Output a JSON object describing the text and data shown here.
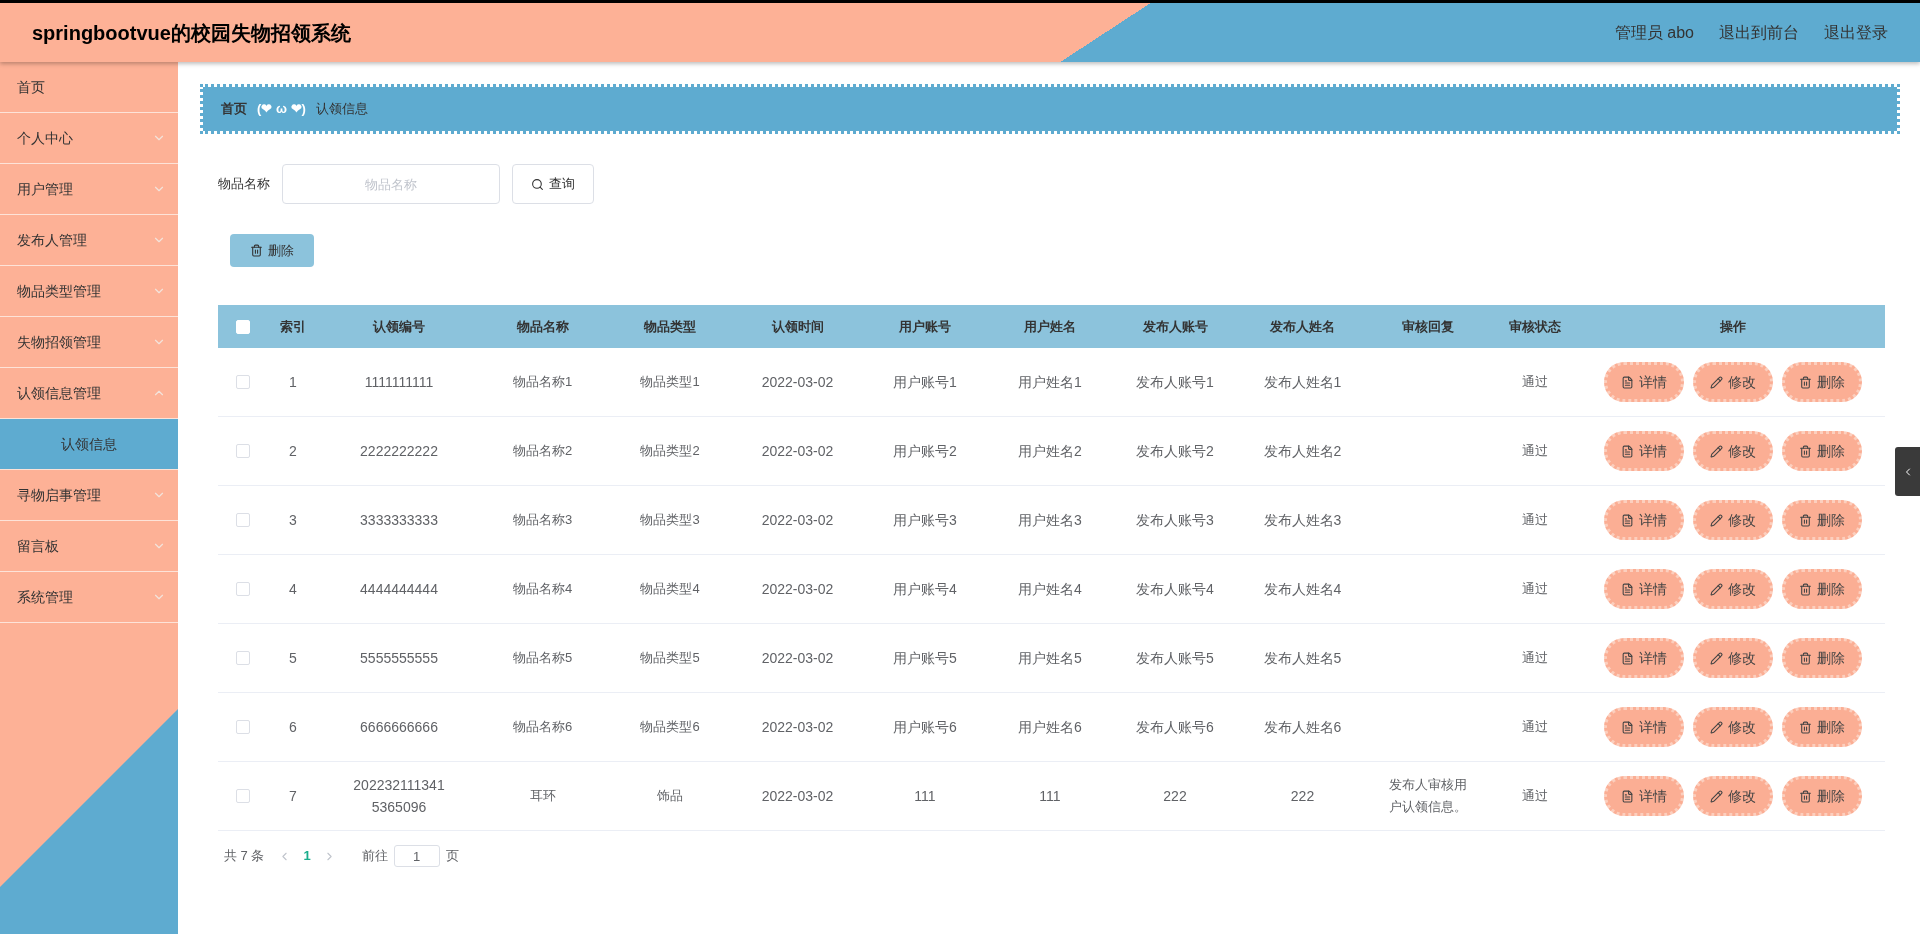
{
  "header": {
    "title": "springbootvue的校园失物招领系统",
    "user": "管理员 abo",
    "links": [
      "退出到前台",
      "退出登录"
    ]
  },
  "sidebar": {
    "items": [
      {
        "label": "首页",
        "kind": "link"
      },
      {
        "label": "个人中心",
        "kind": "menu",
        "expanded": false
      },
      {
        "label": "用户管理",
        "kind": "menu",
        "expanded": false
      },
      {
        "label": "发布人管理",
        "kind": "menu",
        "expanded": false
      },
      {
        "label": "物品类型管理",
        "kind": "menu",
        "expanded": false
      },
      {
        "label": "失物招领管理",
        "kind": "menu",
        "expanded": false
      },
      {
        "label": "认领信息管理",
        "kind": "menu",
        "expanded": true,
        "children": [
          {
            "label": "认领信息",
            "selected": true
          }
        ]
      },
      {
        "label": "寻物启事管理",
        "kind": "menu",
        "expanded": false
      },
      {
        "label": "留言板",
        "kind": "menu",
        "expanded": false
      },
      {
        "label": "系统管理",
        "kind": "menu",
        "expanded": false
      }
    ]
  },
  "breadcrumb": {
    "items": [
      "首页",
      "认领信息"
    ],
    "separator": "(❤ ω ❤)"
  },
  "search": {
    "label": "物品名称",
    "placeholder": "物品名称",
    "button": "查询"
  },
  "toolbar": {
    "delete_button": "删除"
  },
  "table": {
    "select_all_checked": false,
    "columns": [
      "索引",
      "认领编号",
      "物品名称",
      "物品类型",
      "认领时间",
      "用户账号",
      "用户姓名",
      "发布人账号",
      "发布人姓名",
      "审核回复",
      "审核状态",
      "操作"
    ],
    "rows": [
      {
        "checked": false,
        "cells": [
          "1",
          "1111111111",
          "物品名称1",
          "物品类型1",
          "2022-03-02",
          "用户账号1",
          "用户姓名1",
          "发布人账号1",
          "发布人姓名1",
          "",
          "通过"
        ],
        "actions": [
          "详情",
          "修改",
          "删除"
        ]
      },
      {
        "checked": false,
        "cells": [
          "2",
          "2222222222",
          "物品名称2",
          "物品类型2",
          "2022-03-02",
          "用户账号2",
          "用户姓名2",
          "发布人账号2",
          "发布人姓名2",
          "",
          "通过"
        ],
        "actions": [
          "详情",
          "修改",
          "删除"
        ]
      },
      {
        "checked": false,
        "cells": [
          "3",
          "3333333333",
          "物品名称3",
          "物品类型3",
          "2022-03-02",
          "用户账号3",
          "用户姓名3",
          "发布人账号3",
          "发布人姓名3",
          "",
          "通过"
        ],
        "actions": [
          "详情",
          "修改",
          "删除"
        ]
      },
      {
        "checked": false,
        "cells": [
          "4",
          "4444444444",
          "物品名称4",
          "物品类型4",
          "2022-03-02",
          "用户账号4",
          "用户姓名4",
          "发布人账号4",
          "发布人姓名4",
          "",
          "通过"
        ],
        "actions": [
          "详情",
          "修改",
          "删除"
        ]
      },
      {
        "checked": false,
        "cells": [
          "5",
          "5555555555",
          "物品名称5",
          "物品类型5",
          "2022-03-02",
          "用户账号5",
          "用户姓名5",
          "发布人账号5",
          "发布人姓名5",
          "",
          "通过"
        ],
        "actions": [
          "详情",
          "修改",
          "删除"
        ]
      },
      {
        "checked": false,
        "cells": [
          "6",
          "6666666666",
          "物品名称6",
          "物品类型6",
          "2022-03-02",
          "用户账号6",
          "用户姓名6",
          "发布人账号6",
          "发布人姓名6",
          "",
          "通过"
        ],
        "actions": [
          "详情",
          "修改",
          "删除"
        ]
      },
      {
        "checked": false,
        "cells": [
          "7",
          "2022321113415365096",
          "耳环",
          "饰品",
          "2022-03-02",
          "111",
          "111",
          "222",
          "222",
          "发布人审核用户认领信息。",
          "通过"
        ],
        "actions": [
          "详情",
          "修改",
          "删除"
        ]
      }
    ]
  },
  "pagination": {
    "total": "共 7 条",
    "pages": [
      {
        "label": "1",
        "selected": true
      }
    ],
    "goto_label": "前往",
    "goto_value": "1",
    "page_suffix": "页"
  }
}
